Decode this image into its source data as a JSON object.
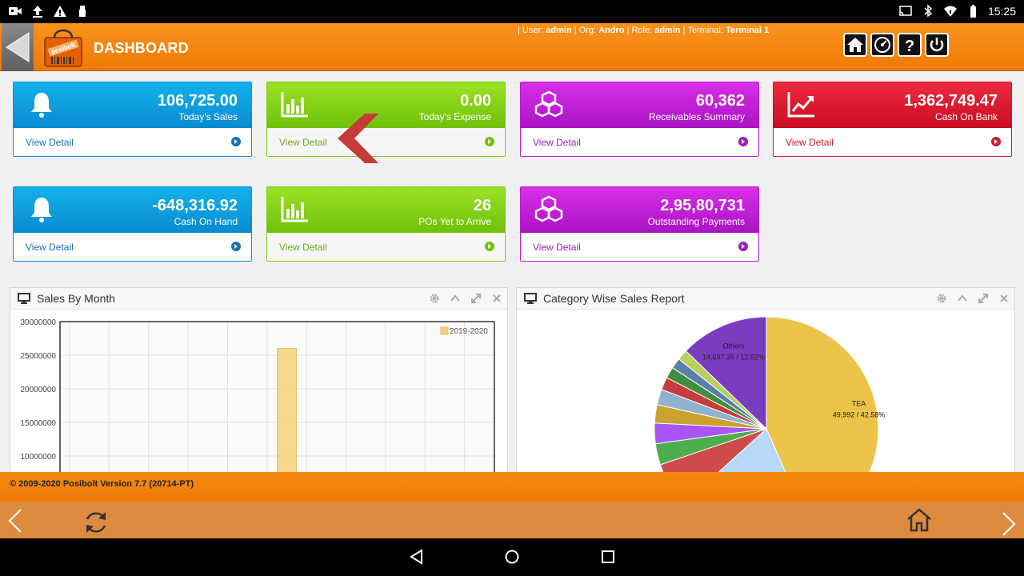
{
  "statusbar": {
    "time": "15:25"
  },
  "header": {
    "title": "DASHBOARD",
    "logo_text": "posibolt",
    "user_prefix": "| User: ",
    "user": "admin",
    "org_prefix": " | Org: ",
    "org": "Andro",
    "role_prefix": " | Role: ",
    "role": "admin",
    "terminal_prefix": " | Terminal: ",
    "terminal": "Terminal 1",
    "icons": [
      "home-icon",
      "dashboard-gauge-icon",
      "help-icon",
      "power-icon"
    ]
  },
  "cards": [
    {
      "value": "106,725.00",
      "label": "Today's Sales",
      "link": "View Detail",
      "color": "#0a8ad0",
      "icon": "bell-icon"
    },
    {
      "value": "0.00",
      "label": "Today's Expense",
      "link": "View Detail",
      "color": "#6fc10b",
      "icon": "bar-chart-icon"
    },
    {
      "value": "60,362",
      "label": "Receivables Summary",
      "link": "View Detail",
      "color": "#a913c4",
      "icon": "cubes-icon"
    },
    {
      "value": "1,362,749.47",
      "label": "Cash On Bank",
      "link": "View Detail",
      "color": "#c90c24",
      "icon": "trend-up-icon"
    },
    {
      "value": "-648,316.92",
      "label": "Cash On Hand",
      "link": "View Detail",
      "color": "#0a8ad0",
      "icon": "bell-icon"
    },
    {
      "value": "26",
      "label": "POs Yet to Arrive",
      "link": "View Detail",
      "color": "#6fc10b",
      "icon": "bar-chart-icon"
    },
    {
      "value": "2,95,80,731",
      "label": "Outstanding Payments",
      "link": "View Detail",
      "color": "#a913c4",
      "icon": "cubes-icon"
    }
  ],
  "panels": {
    "sales_by_month": {
      "title": "Sales By Month"
    },
    "category_sales": {
      "title": "Category Wise Sales Report"
    }
  },
  "chart_data": [
    {
      "type": "bar",
      "title": "Sales By Month",
      "series": [
        {
          "name": "2019-2020",
          "color": "#f3d27a",
          "values": [
            0,
            0,
            0,
            0,
            0,
            26000000,
            0,
            0,
            0,
            0,
            0
          ]
        }
      ],
      "categories": [
        "",
        "",
        "",
        "",
        "",
        "",
        "",
        "",
        "",
        "",
        ""
      ],
      "yticks": [
        "30000000",
        "25000000",
        "20000000",
        "15000000",
        "10000000"
      ],
      "ylim": [
        0,
        30000000
      ],
      "grid": true,
      "legend": "top-right"
    },
    {
      "type": "pie",
      "title": "Category Wise Sales Report",
      "slices": [
        {
          "label": "TEA",
          "text": "49,992 / 42.58%",
          "value": 42.58,
          "color": "#ecc44a"
        },
        {
          "label": "",
          "text": "",
          "value": 19.5,
          "color": "#b8d8f8"
        },
        {
          "label": "",
          "text": "",
          "value": 6.4,
          "color": "#cf4b4b"
        },
        {
          "label": "",
          "text": "",
          "value": 3.0,
          "color": "#4cae4c"
        },
        {
          "label": "",
          "text": "",
          "value": 2.9,
          "color": "#a855f7"
        },
        {
          "label": "",
          "text": "",
          "value": 2.6,
          "color": "#c9a230"
        },
        {
          "label": "",
          "text": "",
          "value": 2.2,
          "color": "#8fb3cf"
        },
        {
          "label": "",
          "text": "",
          "value": 1.8,
          "color": "#c53c3c"
        },
        {
          "label": "",
          "text": "",
          "value": 1.6,
          "color": "#3f8f3f"
        },
        {
          "label": "",
          "text": "",
          "value": 1.5,
          "color": "#5a7fa8"
        },
        {
          "label": "",
          "text": "",
          "value": 1.5,
          "color": "#b8d060"
        },
        {
          "label": "Others",
          "text": "14,697.35 / 12.52%",
          "value": 12.52,
          "color": "#7b3cbf"
        }
      ]
    }
  ],
  "footer": {
    "copyright": "© 2009-2020 Posibolt Version 7.7 (20714-PT)"
  }
}
